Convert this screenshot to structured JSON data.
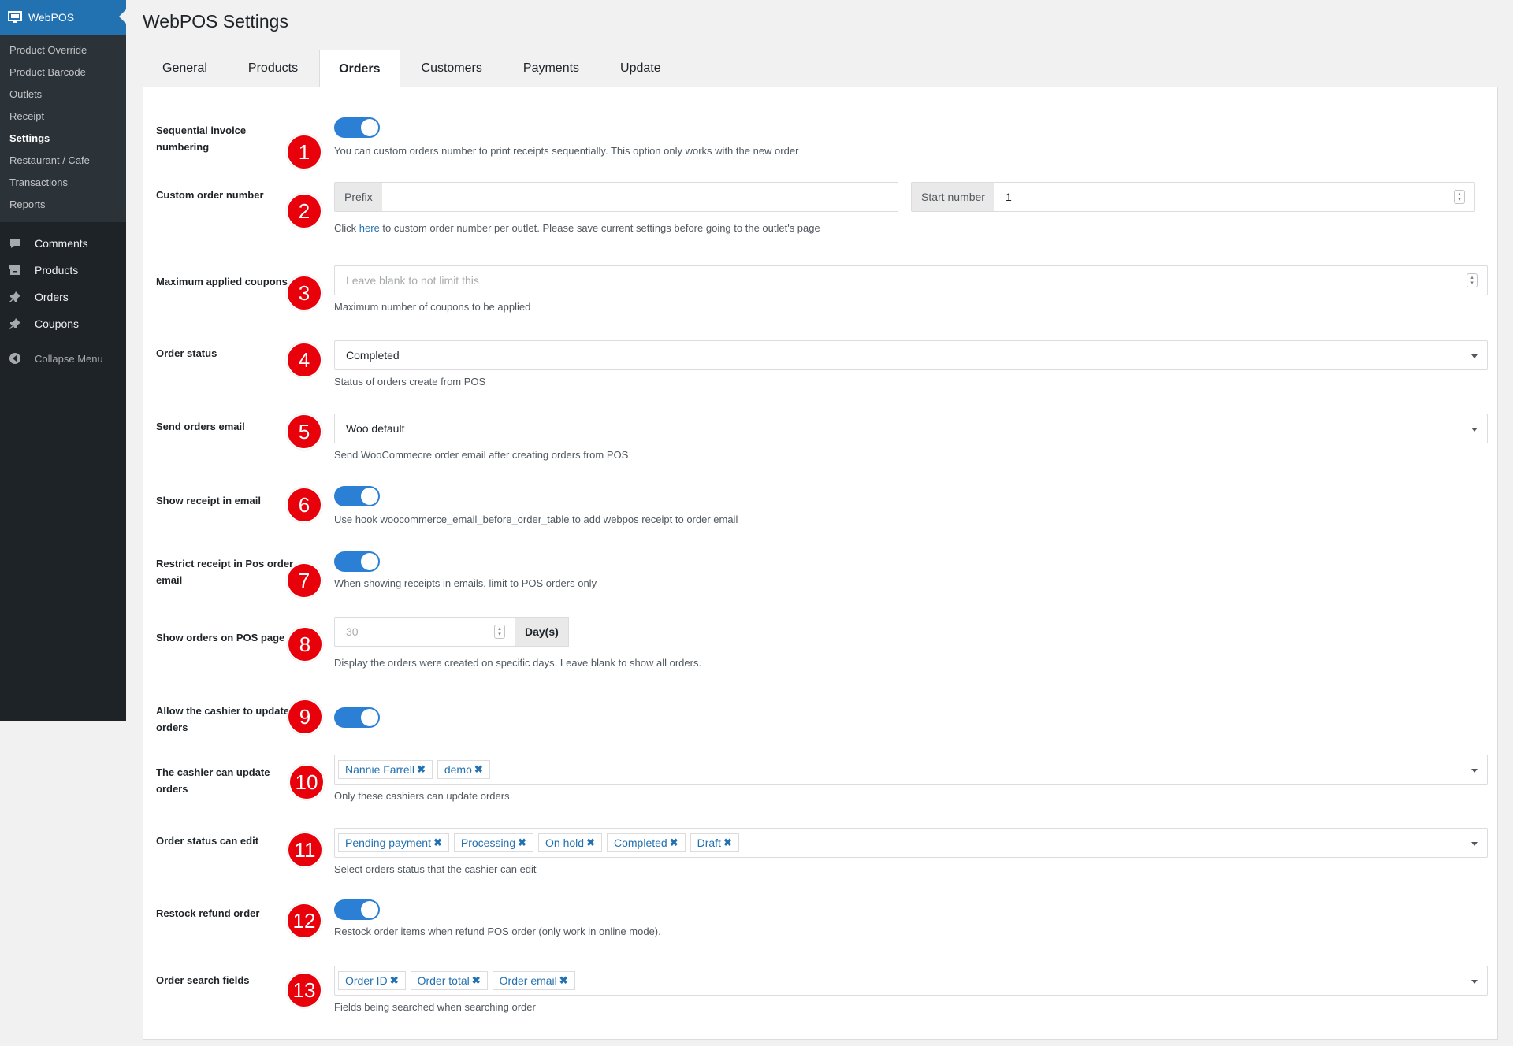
{
  "sidebar": {
    "app_title": "WebPOS",
    "sub_items": [
      "Product Override",
      "Product Barcode",
      "Outlets",
      "Receipt",
      "Settings",
      "Restaurant / Cafe",
      "Transactions",
      "Reports"
    ],
    "main_items": [
      {
        "label": "Comments",
        "icon": "comment-icon"
      },
      {
        "label": "Products",
        "icon": "archive-icon"
      },
      {
        "label": "Orders",
        "icon": "pin-icon"
      },
      {
        "label": "Coupons",
        "icon": "pin-icon"
      }
    ],
    "collapse": "Collapse Menu"
  },
  "page": {
    "title": "WebPOS Settings"
  },
  "tabs": [
    "General",
    "Products",
    "Orders",
    "Customers",
    "Payments",
    "Update"
  ],
  "active_tab": "Orders",
  "settings": {
    "seq": {
      "label": "Sequential invoice numbering",
      "desc": "You can custom orders number to print receipts sequentially. This option only works with the new order",
      "badge": "1",
      "on": true
    },
    "custom": {
      "label": "Custom order number",
      "prefix_label": "Prefix",
      "prefix_value": "",
      "start_label": "Start number",
      "start_value": "1",
      "desc_pre": "Click ",
      "desc_link": "here",
      "desc_post": " to custom order number per outlet. Please save current settings before going to the outlet's page",
      "badge": "2"
    },
    "coupons": {
      "label": "Maximum applied coupons",
      "placeholder": "Leave blank to not limit this",
      "desc": "Maximum number of coupons to be applied",
      "badge": "3"
    },
    "status": {
      "label": "Order status",
      "value": "Completed",
      "desc": "Status of orders create from POS",
      "badge": "4"
    },
    "email": {
      "label": "Send orders email",
      "value": "Woo default",
      "desc": "Send WooCommecre order email after creating orders from POS",
      "badge": "5"
    },
    "receipt_email": {
      "label": "Show receipt in email",
      "desc": "Use hook woocommerce_email_before_order_table to add webpos receipt to order email",
      "badge": "6",
      "on": true
    },
    "restrict": {
      "label": "Restrict receipt in Pos order email",
      "desc": "When showing receipts in emails, limit to POS orders only",
      "badge": "7",
      "on": true
    },
    "show_orders": {
      "label": "Show orders on POS page",
      "placeholder": "30",
      "unit": "Day(s)",
      "desc": "Display the orders were created on specific days. Leave blank to show all orders.",
      "badge": "8"
    },
    "allow_update": {
      "label": "Allow the cashier to update orders",
      "badge": "9",
      "on": true
    },
    "cashiers": {
      "label": "The cashier can update orders",
      "tags": [
        "Nannie Farrell",
        "demo"
      ],
      "desc": "Only these cashiers can update orders",
      "badge": "10"
    },
    "status_edit": {
      "label": "Order status can edit",
      "tags": [
        "Pending payment",
        "Processing",
        "On hold",
        "Completed",
        "Draft"
      ],
      "desc": "Select orders status that the cashier can edit",
      "badge": "11"
    },
    "restock": {
      "label": "Restock refund order",
      "desc": "Restock order items when refund POS order (only work in online mode).",
      "badge": "12",
      "on": true
    },
    "search": {
      "label": "Order search fields",
      "tags": [
        "Order ID",
        "Order total",
        "Order email"
      ],
      "desc": "Fields being searched when searching order",
      "badge": "13"
    }
  },
  "colors": {
    "accent": "#2271b1",
    "toggle": "#2b7fd4",
    "badge": "#e8000b",
    "sidebar": "#1d2327"
  }
}
